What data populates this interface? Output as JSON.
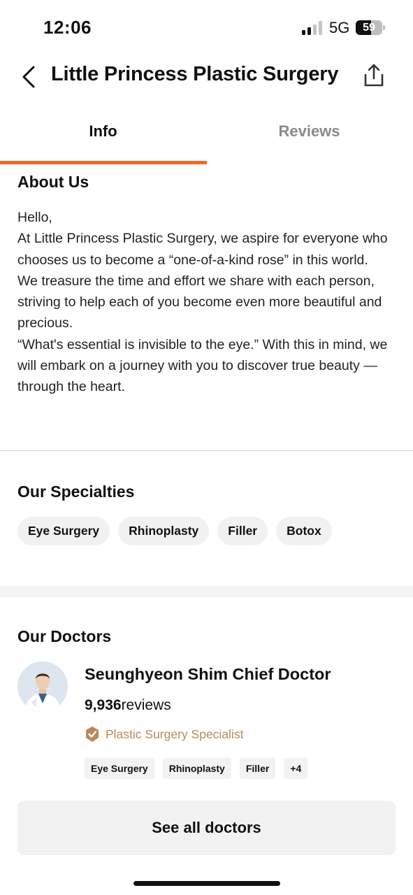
{
  "status_bar": {
    "time": "12:06",
    "network": "5G",
    "battery": "59",
    "battery_level": 0.59,
    "signal_bars_active": 2,
    "signal_bars_total": 4
  },
  "header": {
    "title": "Little Princess Plastic Surgery",
    "back_icon": "chevron-left-icon",
    "share_icon": "share-icon"
  },
  "tabs": [
    {
      "label": "Info",
      "active": true
    },
    {
      "label": "Reviews",
      "active": false
    }
  ],
  "about": {
    "title": "About Us",
    "paragraphs": [
      "Hello,",
      "At Little Princess Plastic Surgery, we aspire for everyone who chooses us to become a “one-of-a-kind rose” in this world.",
      "We treasure the time and effort we share with each person, striving to help each of you become even more beautiful and precious.",
      "“What's essential is invisible to the eye.” With this in mind, we will embark on a journey with you to discover true beauty — through the heart."
    ]
  },
  "specialties": {
    "title": "Our Specialties",
    "items": [
      "Eye Surgery",
      "Rhinoplasty",
      "Filler",
      "Botox"
    ]
  },
  "doctors": {
    "title": "Our Doctors",
    "list": [
      {
        "name": "Seunghyeon Shim Chief Doctor",
        "review_count": "9,936",
        "review_label": "reviews",
        "badge": "Plastic Surgery Specialist",
        "tags": [
          "Eye Surgery",
          "Rhinoplasty",
          "Filler",
          "+4"
        ]
      }
    ],
    "see_all_label": "See all doctors"
  },
  "colors": {
    "accent": "#ee6a2c",
    "specialist": "#b88a57",
    "chip_bg": "#f1f1f1"
  }
}
